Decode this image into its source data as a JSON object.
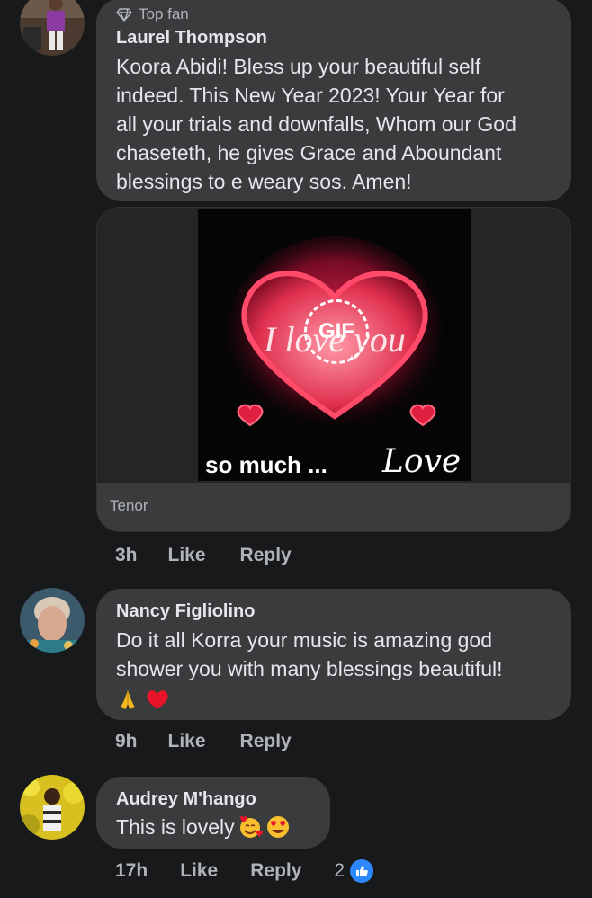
{
  "comments": [
    {
      "badge": "Top fan",
      "author": "Laurel Thompson",
      "text_lines": [
        "Koora Abidi! Bless up your beautiful self",
        "indeed. This New Year 2023! Your Year for",
        "all your trials and downfalls, Whom our God",
        "chaseteth, he gives Grace and Aboundant",
        "blessings to e weary sos. Amen!"
      ],
      "gif": {
        "overlay_label": "GIF",
        "caption_left": "so much ...",
        "caption_right": "Love",
        "script_text": "I love you",
        "source": "Tenor"
      },
      "time": "3h",
      "like_label": "Like",
      "reply_label": "Reply"
    },
    {
      "author": "Nancy Figliolino",
      "text_lines": [
        "Do it all Korra your music is amazing god",
        "shower you with many blessings beautiful!"
      ],
      "emojis": [
        "folded-hands",
        "red-heart"
      ],
      "time": "9h",
      "like_label": "Like",
      "reply_label": "Reply"
    },
    {
      "author": "Audrey M'hango",
      "text": "This is lovely",
      "emojis": [
        "smiling-face-with-hearts",
        "heart-eyes"
      ],
      "time": "17h",
      "like_label": "Like",
      "reply_label": "Reply",
      "reaction_count": "2",
      "reaction_icon": "like-icon"
    }
  ],
  "colors": {
    "background": "#18191a",
    "bubble": "#3a3b3c",
    "secondary_text": "#b0b3b8",
    "like_blue": "#2d88ff"
  }
}
